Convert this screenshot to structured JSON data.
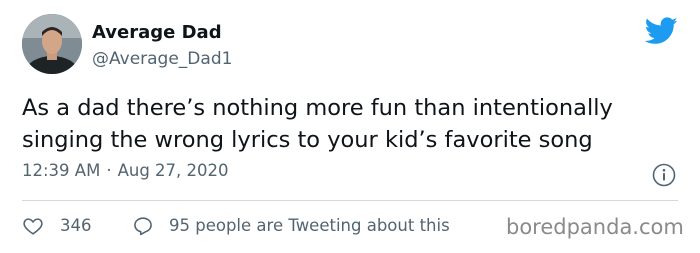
{
  "user": {
    "display_name": "Average Dad",
    "handle": "@Average_Dad1",
    "avatar_icon": "profile-photo"
  },
  "tweet": {
    "text_lines": [
      "As a dad there’s nothing more fun than intentionally",
      "singing the wrong lyrics to your kid’s favorite song"
    ],
    "time": "12:39 AM",
    "separator": "·",
    "date": "Aug 27, 2020"
  },
  "actions": {
    "likes_count": "346",
    "replies_text": "95 people are Tweeting about this"
  },
  "watermark": "boredpanda.com",
  "icons": {
    "brand": "twitter-bird-icon",
    "info": "info-icon",
    "like": "heart-icon",
    "reply": "reply-bubble-icon"
  },
  "colors": {
    "twitter_blue": "#1d9bf0",
    "text_primary": "#0f1419",
    "text_secondary": "#536471",
    "divider": "#cfd9de"
  }
}
